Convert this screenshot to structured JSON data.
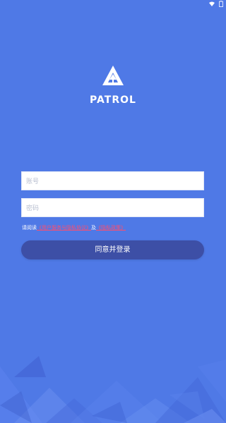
{
  "app": {
    "title": "PATROL"
  },
  "form": {
    "account_placeholder": "账号",
    "password_placeholder": "密码"
  },
  "agreement": {
    "prefix": "请阅读",
    "link1": "《用户服务与隐私协议》",
    "middle": "及",
    "link2": "《隐私政策》"
  },
  "actions": {
    "login_label": "同意并登录"
  },
  "colors": {
    "background": "#4f79e6",
    "button": "#3d4fa6",
    "link": "#ff4d6d"
  }
}
